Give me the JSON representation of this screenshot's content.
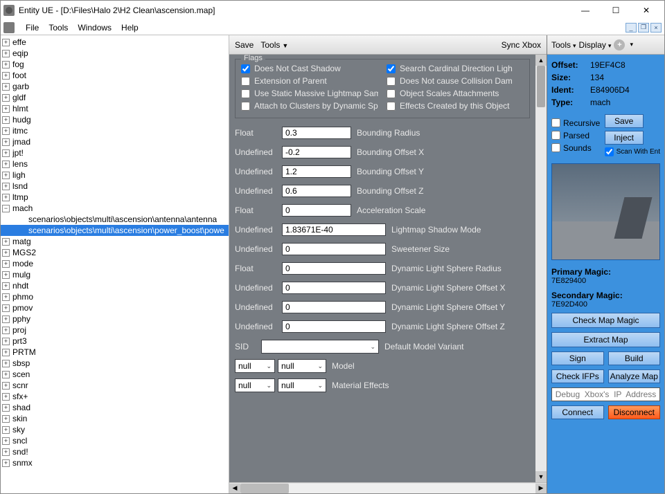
{
  "window": {
    "title": "Entity UE - [D:\\Files\\Halo 2\\H2 Clean\\ascension.map]"
  },
  "menu": {
    "file": "File",
    "tools": "Tools",
    "windows": "Windows",
    "help": "Help"
  },
  "tree": {
    "expanded_key": "mach",
    "children": [
      "scenarios\\objects\\multi\\ascension\\antenna\\antenna",
      "scenarios\\objects\\multi\\ascension\\power_boost\\powe"
    ],
    "items": [
      "effe",
      "eqip",
      "fog",
      "foot",
      "garb",
      "gldf",
      "hlmt",
      "hudg",
      "itmc",
      "jmad",
      "jpt!",
      "lens",
      "ligh",
      "lsnd",
      "ltmp",
      "mach",
      "matg",
      "MGS2",
      "mode",
      "mulg",
      "nhdt",
      "phmo",
      "pmov",
      "pphy",
      "proj",
      "prt3",
      "PRTM",
      "sbsp",
      "scen",
      "scnr",
      "sfx+",
      "shad",
      "skin",
      "sky",
      "sncl",
      "snd!",
      "snmx"
    ]
  },
  "center_toolbar": {
    "save": "Save",
    "tools": "Tools",
    "sync": "Sync Xbox"
  },
  "flags": {
    "legend": "Flags",
    "items": [
      {
        "label": "Does Not Cast Shadow",
        "checked": true
      },
      {
        "label": "Search Cardinal Direction Ligh",
        "checked": true
      },
      {
        "label": "Extension of Parent",
        "checked": false
      },
      {
        "label": "Does Not cause Collision Dam",
        "checked": false
      },
      {
        "label": "Use Static Massive Lightmap Sample",
        "checked": false
      },
      {
        "label": "Object Scales Attachments",
        "checked": false
      },
      {
        "label": "Attach to Clusters by Dynamic Sphere",
        "checked": false
      },
      {
        "label": "Effects Created by this Object",
        "checked": false
      }
    ]
  },
  "props": [
    {
      "t": "Float",
      "v": "0.3",
      "lbl": "Bounding Radius"
    },
    {
      "t": "Undefined",
      "v": "-0.2",
      "lbl": "Bounding Offset X"
    },
    {
      "t": "Undefined",
      "v": "1.2",
      "lbl": "Bounding Offset Y"
    },
    {
      "t": "Undefined",
      "v": "0.6",
      "lbl": "Bounding Offset Z"
    },
    {
      "t": "Float",
      "v": "0",
      "lbl": "Acceleration Scale"
    },
    {
      "t": "Undefined",
      "v": "1.83671E-40",
      "lbl": "Lightmap Shadow Mode",
      "wide": true
    },
    {
      "t": "Undefined",
      "v": "0",
      "lbl": "Sweetener Size",
      "wide": true
    },
    {
      "t": "Float",
      "v": "0",
      "lbl": "Dynamic Light Sphere Radius",
      "wide": true
    },
    {
      "t": "Undefined",
      "v": "0",
      "lbl": "Dynamic Light Sphere Offset X",
      "wide": true
    },
    {
      "t": "Undefined",
      "v": "0",
      "lbl": "Dynamic Light Sphere Offset Y",
      "wide": true
    },
    {
      "t": "Undefined",
      "v": "0",
      "lbl": "Dynamic Light Sphere Offset Z",
      "wide": true
    }
  ],
  "sid": {
    "label_left": "SID",
    "label_right": "Default Model Variant"
  },
  "combo_rows": [
    {
      "a": "null",
      "b": "null",
      "lbl": "Model"
    },
    {
      "a": "null",
      "b": "null",
      "lbl": "Material Effects"
    }
  ],
  "right_toolbar": {
    "tools": "Tools",
    "display": "Display"
  },
  "info": {
    "offset_k": "Offset:",
    "offset_v": "19EF4C8",
    "size_k": "Size:",
    "size_v": "134",
    "ident_k": "Ident:",
    "ident_v": "E84906D4",
    "type_k": "Type:",
    "type_v": "mach"
  },
  "right_checks": {
    "recursive": "Recursive",
    "parsed": "Parsed",
    "sounds": "Sounds",
    "scan": "Scan With Ent",
    "scan_checked": true
  },
  "right_btns": {
    "save": "Save",
    "inject": "Inject"
  },
  "magic": {
    "primary_k": "Primary Magic:",
    "primary_v": "7E829400",
    "secondary_k": "Secondary Magic:",
    "secondary_v": "7E92D400"
  },
  "actions": {
    "check": "Check Map Magic",
    "extract": "Extract Map",
    "sign": "Sign",
    "build": "Build",
    "ifp": "Check IFPs",
    "analyze": "Analyze Map",
    "ip_placeholder": "Debug  Xbox's  IP  Address",
    "connect": "Connect",
    "disconnect": "Disconnect"
  }
}
